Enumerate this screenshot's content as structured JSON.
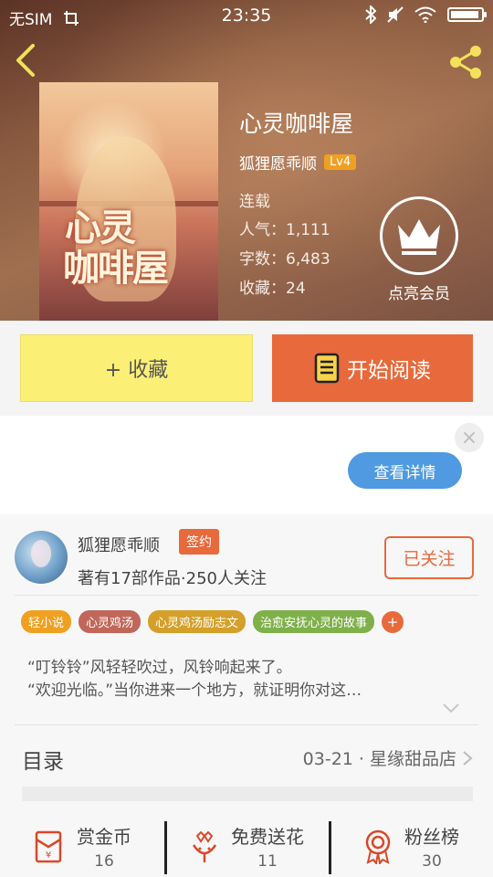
{
  "status_bar": {
    "carrier": "无SIM",
    "time": "23:35"
  },
  "book": {
    "title": "心灵咖啡屋",
    "cover_title_line1": "心灵",
    "cover_title_line2": "咖啡屋",
    "author": "狐狸愿乖顺",
    "level": "Lv4",
    "status": "连载",
    "popularity": "人气：1,111",
    "word_count": "字数：6,483",
    "favorites": "收藏：24"
  },
  "vip": {
    "label": "点亮会员"
  },
  "actions": {
    "favorite_label": "+ 收藏",
    "read_label": "开始阅读"
  },
  "ad": {
    "close": "×",
    "details_label": "查看详情"
  },
  "author_card": {
    "name": "狐狸愿乖顺",
    "badge": "签约",
    "description": "著有17部作品·250人关注",
    "follow_label": "已关注"
  },
  "tags": [
    {
      "label": "轻小说",
      "color": "#f0a020"
    },
    {
      "label": "心灵鸡汤",
      "color": "#c0675a"
    },
    {
      "label": "心灵鸡汤励志文",
      "color": "#d4a02a"
    },
    {
      "label": "治愈安抚心灵的故事",
      "color": "#7fb04a"
    }
  ],
  "tag_more": "+",
  "intro": {
    "line1": "“叮铃铃”风轻轻吹过，风铃响起来了。",
    "line2": "“欢迎光临。”当你进来一个地方，就证明你对这…"
  },
  "toc": {
    "label": "目录",
    "latest": "03-21 · 星缘甜品店"
  },
  "stats": [
    {
      "label": "赏金币",
      "value": "16",
      "icon": "red-envelope-icon"
    },
    {
      "label": "免费送花",
      "value": "11",
      "icon": "flower-icon"
    },
    {
      "label": "粉丝榜",
      "value": "30",
      "icon": "medal-icon"
    }
  ],
  "colors": {
    "accent": "#e8693b",
    "favorite_button": "#fbf075",
    "ad_button": "#4f9ae0",
    "level_badge": "#f0a020"
  }
}
